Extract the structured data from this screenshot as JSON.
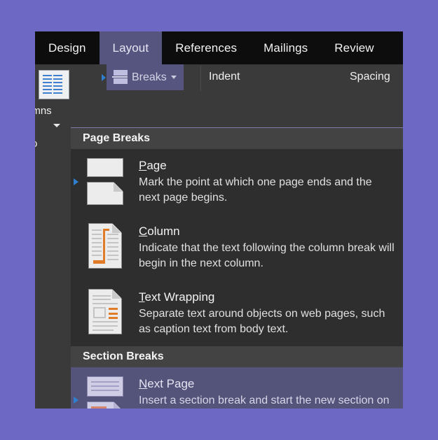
{
  "window": {
    "background_color": "#6c68c4",
    "chrome_color": "#2b2b2b"
  },
  "ribbon_tabs": {
    "active": "Layout",
    "items": [
      {
        "label": "Design",
        "active": false
      },
      {
        "label": "Layout",
        "active": true
      },
      {
        "label": "References",
        "active": false
      },
      {
        "label": "Mailings",
        "active": false
      },
      {
        "label": "Review",
        "active": false
      }
    ]
  },
  "ribbon": {
    "left_group": {
      "icon": "columns-icon",
      "label": "umns",
      "full_label": "Columns",
      "dropdown_caret": "chevron-down-icon",
      "extra_label": "o"
    },
    "breaks_button": {
      "label": "Breaks",
      "icon": "page-break-icon",
      "caret": "chevron-down-icon",
      "active": true
    },
    "labels": [
      {
        "name": "indent-label",
        "text": "Indent"
      },
      {
        "name": "spacing-label",
        "text": "Spacing"
      }
    ]
  },
  "breaks_menu": {
    "sections": [
      {
        "header": "Page Breaks",
        "items": [
          {
            "title": "Page",
            "accel": "P",
            "description": "Mark the point at which one page ends and the next page begins.",
            "icon": "page-break-icon",
            "selected": false
          },
          {
            "title": "Column",
            "accel": "C",
            "description": "Indicate that the text following the column break will begin in the next column.",
            "icon": "column-break-icon",
            "selected": false
          },
          {
            "title": "Text Wrapping",
            "accel": "T",
            "description": "Separate text around objects on web pages, such as caption text from body text.",
            "icon": "text-wrapping-break-icon",
            "selected": false
          }
        ]
      },
      {
        "header": "Section Breaks",
        "items": [
          {
            "title": "Next Page",
            "accel": "N",
            "description": "Insert a section break and start the new section on the next page.",
            "icon": "next-page-break-icon",
            "selected": true
          }
        ]
      }
    ]
  },
  "colors": {
    "accent_purple": "#56557f",
    "selection_purple": "#54537a",
    "marker_blue": "#2f7fd0",
    "icon_orange": "#e07b28",
    "menu_bg": "#2e2e2e",
    "section_header_bg": "#434343"
  }
}
